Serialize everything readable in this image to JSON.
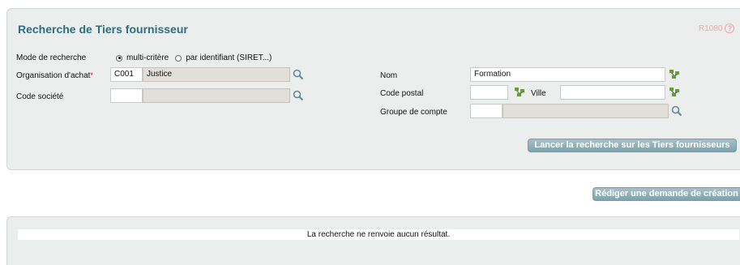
{
  "header": {
    "title": "Recherche de Tiers fournisseur",
    "code": "R1080",
    "help_glyph": "?"
  },
  "search_mode": {
    "label": "Mode de recherche",
    "options": [
      {
        "label": "multi-critère",
        "selected": true
      },
      {
        "label": "par identifiant (SIRET...)",
        "selected": false
      }
    ]
  },
  "organisation": {
    "label": "Organisation d'achat",
    "required_mark": "*",
    "code_value": "C001",
    "name_value": "Justice"
  },
  "societe": {
    "label": "Code société",
    "code_value": "",
    "name_value": ""
  },
  "nom": {
    "label": "Nom",
    "value": "Formation"
  },
  "code_postal": {
    "label": "Code postal",
    "value": ""
  },
  "ville": {
    "label": "Ville",
    "value": ""
  },
  "groupe_compte": {
    "label": "Groupe de compte",
    "code_value": "",
    "name_value": ""
  },
  "buttons": {
    "search": "Lancer la recherche sur les Tiers fournisseurs",
    "create": "Rédiger une demande de création"
  },
  "results": {
    "message": "La recherche ne renvoie aucun résultat."
  },
  "colors": {
    "title": "#2f6e80",
    "button": "#8fb0b8",
    "panel": "#eceded",
    "readonly": "#e2dfd8"
  }
}
